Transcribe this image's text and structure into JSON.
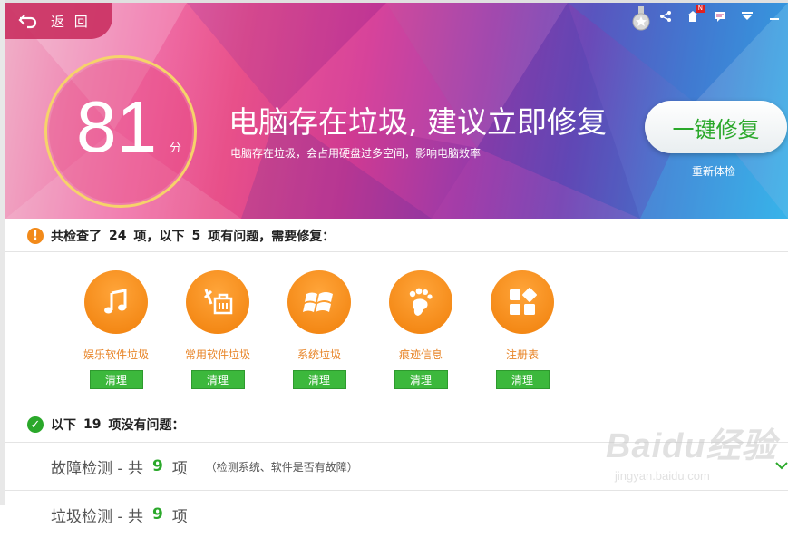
{
  "header": {
    "back_label": "返 回",
    "score": "81",
    "score_unit": "分",
    "headline": "电脑存在垃圾, 建议立即修复",
    "subline": "电脑存在垃圾，会占用硬盘过多空间，影响电脑效率",
    "fix_button": "一键修复",
    "recheck": "重新体检",
    "toolbar_icons": [
      "medal-icon",
      "share-icon",
      "notification-icon",
      "message-icon",
      "menu-icon",
      "minimize-icon"
    ],
    "badge_text": "N"
  },
  "problems": {
    "prefix": "共检查了",
    "total": "24",
    "mid": "项，以下",
    "count": "5",
    "suffix": "项有问题，需要修复：",
    "items": [
      {
        "label": "娱乐软件垃圾",
        "button": "清理",
        "icon": "music-icon"
      },
      {
        "label": "常用软件垃圾",
        "button": "清理",
        "icon": "tools-icon"
      },
      {
        "label": "系统垃圾",
        "button": "清理",
        "icon": "windows-icon"
      },
      {
        "label": "痕迹信息",
        "button": "清理",
        "icon": "footprint-icon"
      },
      {
        "label": "注册表",
        "button": "清理",
        "icon": "registry-icon"
      }
    ]
  },
  "ok": {
    "prefix": "以下",
    "count": "19",
    "suffix": "项没有问题：",
    "rows": [
      {
        "title": "故障检测 - 共",
        "count": "9",
        "unit": "项",
        "desc": "（检测系统、软件是否有故障）"
      },
      {
        "title": "垃圾检测 - 共",
        "count": "9",
        "unit": "项",
        "desc": ""
      }
    ]
  },
  "watermark": {
    "main": "Baidu经验",
    "sub": "jingyan.baidu.com"
  },
  "colors": {
    "accent_orange": "#f28a1a",
    "accent_green": "#3cb83c",
    "ring": "#f6d36a"
  }
}
